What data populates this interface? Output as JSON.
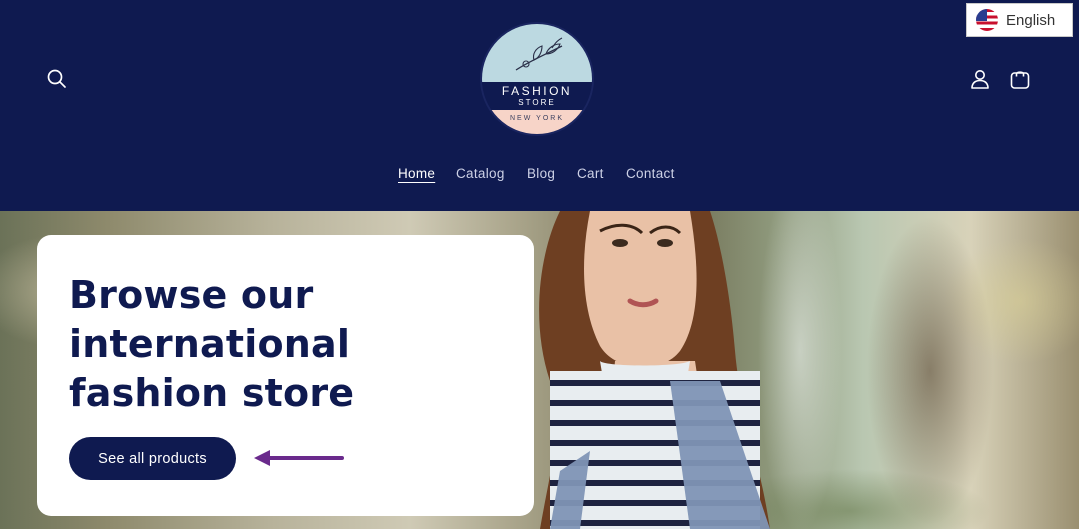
{
  "header": {
    "logo": {
      "line1": "FASHION",
      "line2": "STORE",
      "line3": "NEW YORK"
    },
    "language": {
      "label": "English",
      "flag_icon": "us-flag-icon"
    },
    "icons": {
      "search": "search-icon",
      "account": "user-icon",
      "cart": "shopping-bag-icon"
    }
  },
  "nav": {
    "items": [
      {
        "label": "Home",
        "active": true
      },
      {
        "label": "Catalog",
        "active": false
      },
      {
        "label": "Blog",
        "active": false
      },
      {
        "label": "Cart",
        "active": false
      },
      {
        "label": "Contact",
        "active": false
      }
    ]
  },
  "hero": {
    "title": "Browse our international fashion store",
    "cta_label": "See all products"
  },
  "colors": {
    "brand_navy": "#0f1a50",
    "annotation_arrow": "#6a2a8c"
  }
}
